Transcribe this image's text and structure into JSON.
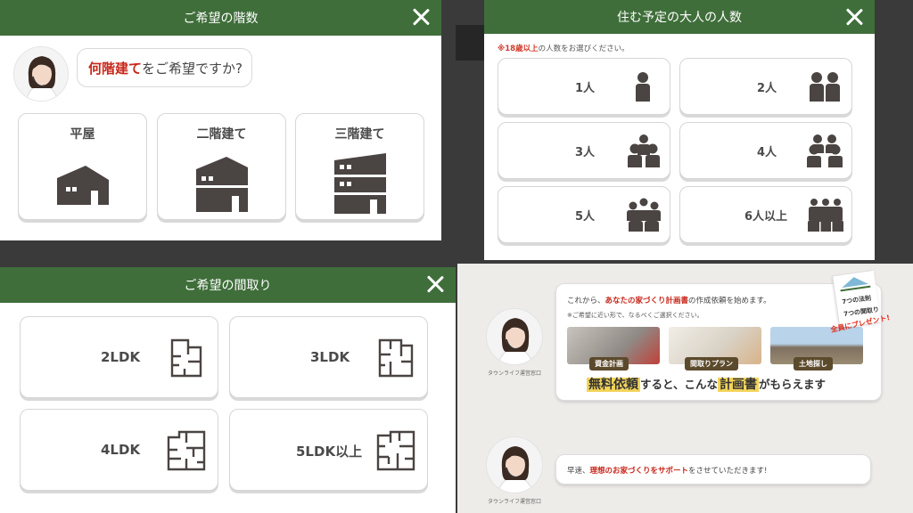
{
  "floors_modal": {
    "title": "ご希望の階数",
    "question_em": "何階建て",
    "question_rest": "をご希望ですか?",
    "options": [
      {
        "label": "平屋",
        "icon": "one-story-house-icon"
      },
      {
        "label": "二階建て",
        "icon": "two-story-house-icon"
      },
      {
        "label": "三階建て",
        "icon": "three-story-house-icon"
      }
    ]
  },
  "adults_modal": {
    "title": "住む予定の大人の人数",
    "note_em": "※18歳以上",
    "note_rest": "の人数をお選びください。",
    "options": [
      {
        "label": "1人",
        "icon": "person-1-icon"
      },
      {
        "label": "2人",
        "icon": "person-2-icon"
      },
      {
        "label": "3人",
        "icon": "person-3-icon"
      },
      {
        "label": "4人",
        "icon": "person-4-icon"
      },
      {
        "label": "5人",
        "icon": "person-5-icon"
      },
      {
        "label": "6人以上",
        "icon": "person-6-icon"
      }
    ]
  },
  "layout_modal": {
    "title": "ご希望の間取り",
    "options": [
      {
        "label": "2LDK",
        "icon": "floorplan-2ldk-icon"
      },
      {
        "label": "3LDK",
        "icon": "floorplan-3ldk-icon"
      },
      {
        "label": "4LDK",
        "icon": "floorplan-4ldk-icon"
      },
      {
        "label": "5LDK以上",
        "icon": "floorplan-5ldk-icon"
      }
    ]
  },
  "chat": {
    "msg1_pre": "これから、",
    "msg1_em": "あなたの家づくり計画書",
    "msg1_post": "の作成依頼を始めます。",
    "msg1_sub": "※ご希望に近い形で、なるべくご選択ください。",
    "photo_tags": [
      "資金計画",
      "間取りプラン",
      "土地探し"
    ],
    "free_hl": "無料依頼",
    "free_mid": "すると、こんな",
    "free_big": "計画書",
    "free_end": "がもらえます",
    "gift_line1": "7つの法則",
    "gift_line2": "7つの間取り",
    "gift_red": "全員にプレゼント!",
    "msg2_pre": "早速、",
    "msg2_em": "理想のお家づくりをサポート",
    "msg2_post": "をさせていただきます!",
    "operator_caption": "タウンライフ運営窓口"
  },
  "colors": {
    "header_green": "#3f6e3a",
    "icon_dark": "#4a4442",
    "accent_red": "#c8271a"
  }
}
